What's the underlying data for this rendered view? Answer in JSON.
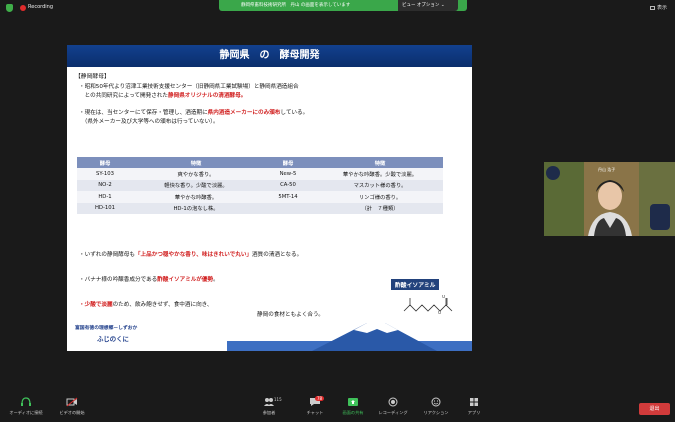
{
  "topbar": {
    "recording_label": "Recording",
    "share_banner": "静岡県畜料技術研究所　丹山 の画面を表示しています",
    "view_options": "ビュー オプション ⌄",
    "view_label": "表示"
  },
  "slide": {
    "title": "静岡県　の　酵母開発",
    "section": "【静岡酵母】",
    "bullet1_line1": "・昭和50年代より沼津工業技術支援センター（旧静岡県工業試験場）と静岡県酒造組合",
    "bullet1_line2_a": "　との共同研究によって開発された",
    "bullet1_line2_red": "静岡県オリジナルの清酒酵母。",
    "bullet2_line1_a": "・現在は、当センターにて保存・管理し、酒造期に",
    "bullet2_line1_red": "県内酒造メーカーにのみ頒布",
    "bullet2_line1_b": "している。",
    "bullet2_line2": "　（県外メーカー及び大学等への頒布は行っていない）。",
    "table": {
      "headers": [
        "酵母",
        "特徴",
        "酵母",
        "特徴"
      ],
      "rows": [
        [
          "SY-103",
          "爽やかな香り。",
          "New-5",
          "華やかな吟醸香。少酸で淡麗。"
        ],
        [
          "NO-2",
          "軽快な香り。少酸で淡麗。",
          "CA-50",
          "マスカット様の香り。"
        ],
        [
          "HD-1",
          "華やかな吟醸香。",
          "5MT-14",
          "リンゴ様の香り。"
        ],
        [
          "HD-101",
          "HD-1の泡なし株。",
          "",
          "（計　７種類）"
        ]
      ]
    },
    "bullet3_a": "・いずれの静岡酵母も",
    "bullet3_red": "「上品かつ穏やかな香り、味はきれいで丸い」",
    "bullet3_b": "酒質の清酒となる。",
    "bullet4_a": "・バナナ様の吟醸香成分である",
    "bullet4_red": "酢酸イソアミルが優勢",
    "bullet4_b": "。",
    "bullet5_red": "・少酸で淡麗",
    "bullet5_a": "のため、飲み飽きせず、食中酒に向き、",
    "bullet5_line2": "静岡の食材ともよく合う。",
    "ester_label": "酢酸イソアミル",
    "logo_line1": "富国有徳の理想郷－しずおか",
    "logo_line2": "ふじのくに"
  },
  "camera": {
    "name": "丹山 浩子"
  },
  "toolbar": {
    "audio": "オーディオに接続",
    "video": "ビデオの開始",
    "participants": "参加者",
    "participants_count": "115",
    "chat": "チャット",
    "chat_badge": "78",
    "share": "画面の共有",
    "record": "レコーディング",
    "reactions": "リアクション",
    "apps": "アプリ",
    "leave": "退出"
  },
  "colors": {
    "banner_green": "#3aa74a",
    "slide_title_blue": "#12408e",
    "table_header": "#7c8fbc",
    "highlight_red": "#d12020",
    "leave_red": "#d13b3b"
  }
}
